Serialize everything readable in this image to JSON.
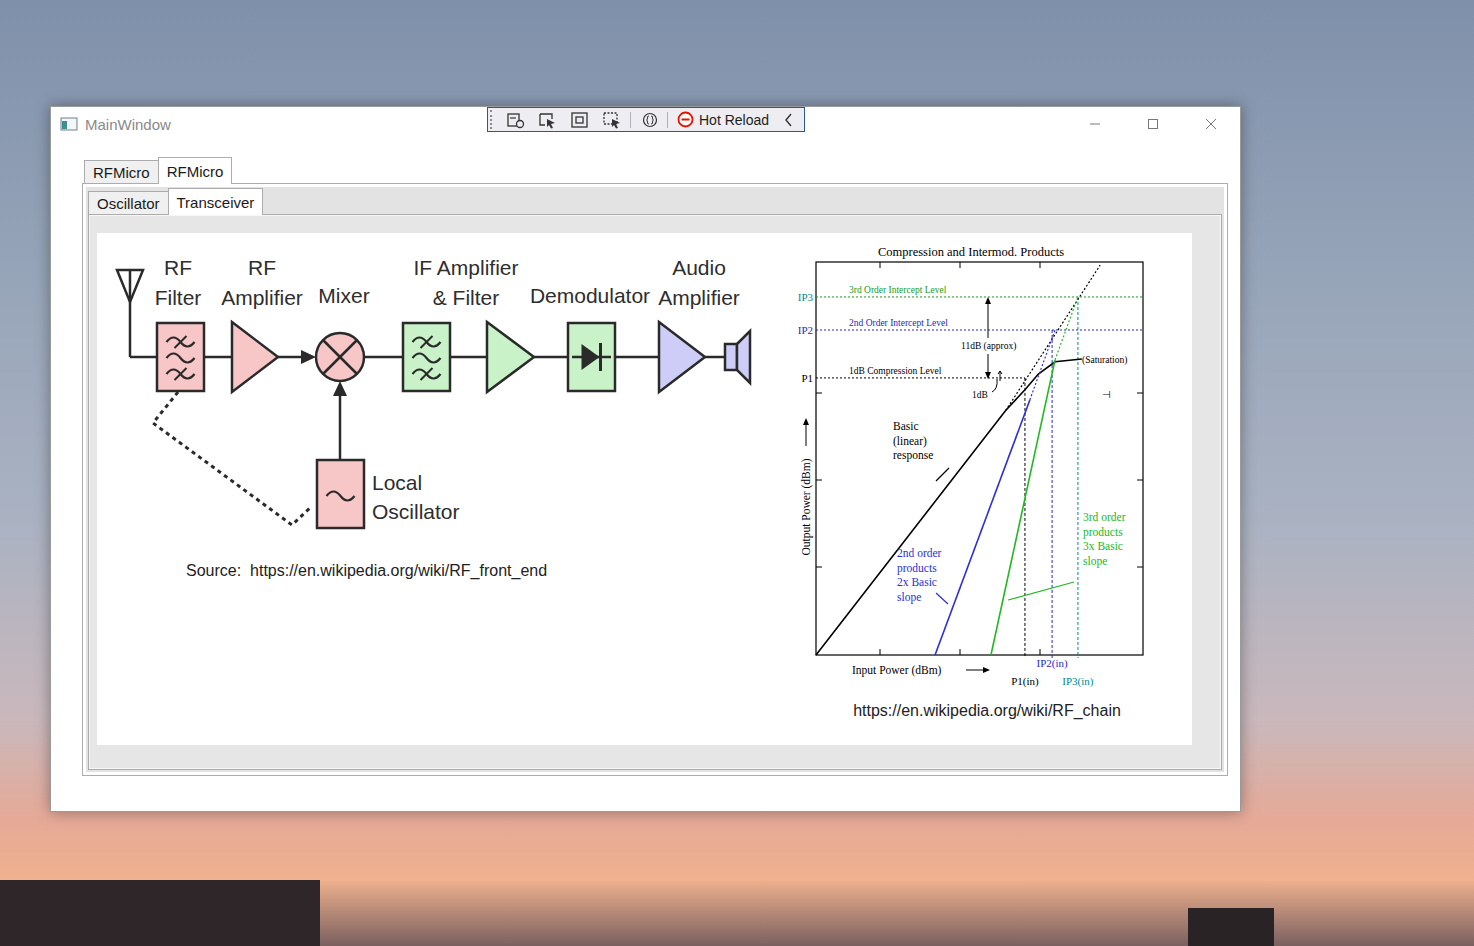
{
  "window": {
    "title": "MainWindow"
  },
  "debug_toolbar": {
    "label": "Hot Reload"
  },
  "outer_tabs": [
    {
      "label": "RFMicro",
      "selected": false
    },
    {
      "label": "RFMicro",
      "selected": true
    }
  ],
  "inner_tabs": [
    {
      "label": "Oscillator",
      "selected": false
    },
    {
      "label": "Transceiver",
      "selected": true
    }
  ],
  "block_diagram": {
    "labels": [
      {
        "lines": [
          "RF",
          "Filter"
        ]
      },
      {
        "lines": [
          "RF",
          "Amplifier"
        ]
      },
      {
        "lines": [
          "Mixer"
        ]
      },
      {
        "lines": [
          "IF Amplifier",
          "& Filter"
        ]
      },
      {
        "lines": [
          "Demodulator"
        ]
      },
      {
        "lines": [
          "Audio",
          "Amplifier"
        ]
      }
    ],
    "blocks": [
      {
        "kind": "filter",
        "color": "#f7c6c6"
      },
      {
        "kind": "amplifier",
        "color": "#f7c6c6"
      },
      {
        "kind": "mixer",
        "color": "#f7c6c6"
      },
      {
        "kind": "filter",
        "color": "#c9f2c9"
      },
      {
        "kind": "amplifier",
        "color": "#c9f2c9"
      },
      {
        "kind": "demodulator",
        "color": "#c9f2c9"
      },
      {
        "kind": "amplifier",
        "color": "#cdcdf7"
      }
    ],
    "oscillator": {
      "lines": [
        "Local",
        "Oscillator"
      ],
      "color": "#f7c6c6"
    },
    "source": "Source:  https://en.wikipedia.org/wiki/RF_front_end"
  },
  "chart": {
    "title": "Compression and Intermod. Products",
    "x_axis_label": "Input Power (dBm)",
    "y_axis_label": "Output Power (dBm)",
    "y_ticks": [
      {
        "label": "IP3",
        "value": 91.1,
        "color": "#008b8b"
      },
      {
        "label": "IP2",
        "value": 82.7,
        "color": "#2828c8"
      },
      {
        "label": "P1",
        "value": 70.5,
        "color": "#000000"
      }
    ],
    "levels": [
      {
        "label": "3rd Order Intercept Level",
        "value": 91.1,
        "color": "#1a9a1a"
      },
      {
        "label": "2nd Order Intercept Level",
        "value": 82.7,
        "color": "#2828c8"
      },
      {
        "label": "1dB Compression Level",
        "value": 70.5,
        "color": "#000000"
      }
    ],
    "x_ticks": [
      {
        "label": "P1(in)",
        "value": 63.9,
        "color": "#000000"
      },
      {
        "label": "IP2(in)",
        "value": 72.2,
        "color": "#2828c8"
      },
      {
        "label": "IP3(in)",
        "value": 80.1,
        "color": "#008b8b"
      }
    ],
    "series": [
      {
        "label_lines": [
          "Basic",
          "(linear)",
          "response"
        ],
        "color": "#000000",
        "points": [
          [
            0,
            0
          ],
          [
            58,
            62.2
          ],
          [
            63.9,
            67.5
          ],
          [
            68,
            71.5
          ],
          [
            73.1,
            74.6
          ],
          [
            81.3,
            75.3
          ]
        ],
        "extension": [
          [
            58,
            62.2
          ],
          [
            86.9,
            99.2
          ]
        ]
      },
      {
        "label_lines": [
          "2nd order",
          "products",
          "2x Basic",
          "slope"
        ],
        "color": "#2e2ed6",
        "points": [
          [
            36.4,
            0
          ],
          [
            65.4,
            64.9
          ]
        ],
        "extension": [
          [
            65.4,
            64.9
          ],
          [
            73.1,
            82.7
          ]
        ]
      },
      {
        "label_lines": [
          "3rd order",
          "products",
          "3x Basic",
          "slope"
        ],
        "color": "#22b822",
        "points": [
          [
            53.5,
            0
          ],
          [
            73.1,
            75.1
          ]
        ],
        "extension": [
          [
            73.1,
            75.1
          ],
          [
            80.1,
            91.1
          ]
        ]
      }
    ],
    "annotations": [
      "11dB (approx)",
      "1dB",
      "(Saturation)",
      "⊣"
    ],
    "source": "https://en.wikipedia.org/wiki/RF_chain"
  }
}
